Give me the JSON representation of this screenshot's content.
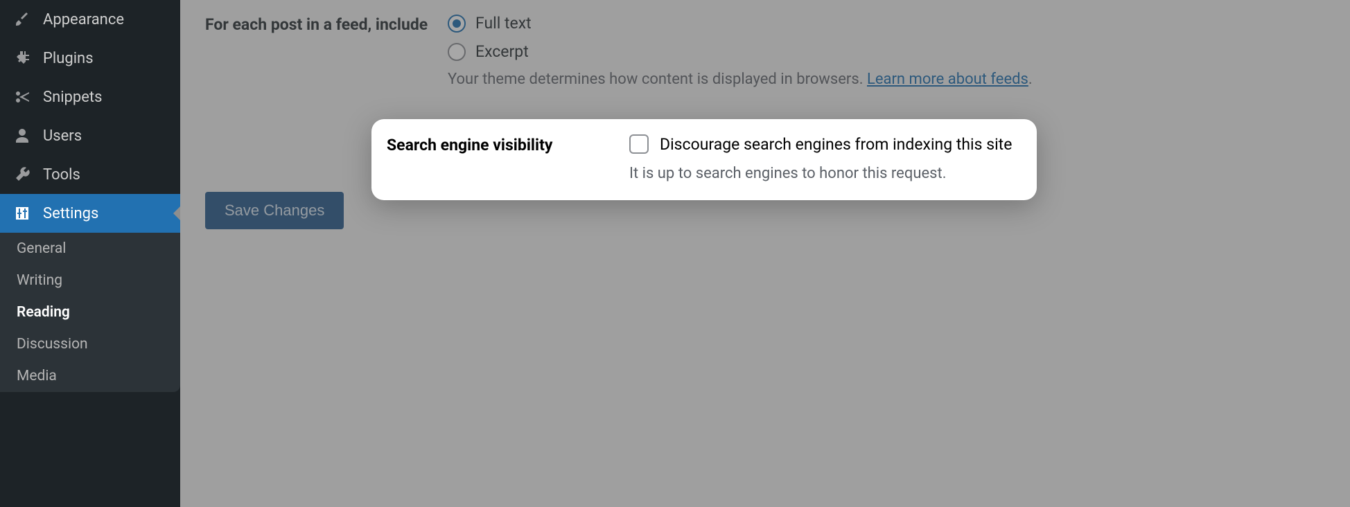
{
  "sidebar": {
    "items": [
      {
        "label": "Appearance"
      },
      {
        "label": "Plugins"
      },
      {
        "label": "Snippets"
      },
      {
        "label": "Users"
      },
      {
        "label": "Tools"
      },
      {
        "label": "Settings"
      }
    ],
    "submenu": [
      {
        "label": "General"
      },
      {
        "label": "Writing"
      },
      {
        "label": "Reading"
      },
      {
        "label": "Discussion"
      },
      {
        "label": "Media"
      }
    ]
  },
  "content": {
    "feed_label": "For each post in a feed, include",
    "feed_option_fulltext": "Full text",
    "feed_option_excerpt": "Excerpt",
    "feed_desc_prefix": "Your theme determines how content is displayed in browsers. ",
    "feed_desc_link": "Learn more about feeds",
    "feed_desc_suffix": ".",
    "sev_label": "Search engine visibility",
    "sev_checkbox_label": "Discourage search engines from indexing this site",
    "sev_desc": "It is up to search engines to honor this request.",
    "save_button": "Save Changes"
  }
}
